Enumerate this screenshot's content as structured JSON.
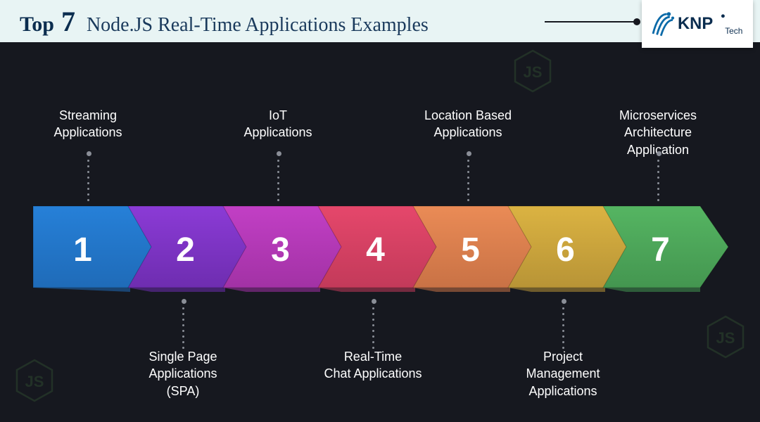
{
  "header": {
    "top_word": "Top",
    "number": "7",
    "subtitle": "Node.JS Real-Time Applications Examples"
  },
  "brand": {
    "name": "KNP Tech"
  },
  "items": [
    {
      "n": "1",
      "label_a": "Streaming",
      "label_b": "Applications",
      "label_c": "",
      "pos": "top",
      "color_a": "#2680d8",
      "color_b": "#1f6bb8"
    },
    {
      "n": "2",
      "label_a": "Single Page",
      "label_b": "Applications",
      "label_c": "(SPA)",
      "pos": "bottom",
      "color_a": "#8b3bd6",
      "color_b": "#6e2db0"
    },
    {
      "n": "3",
      "label_a": "IoT",
      "label_b": "Applications",
      "label_c": "",
      "pos": "top",
      "color_a": "#c23fc5",
      "color_b": "#a232a5"
    },
    {
      "n": "4",
      "label_a": "Real-Time",
      "label_b": "Chat Applications",
      "label_c": "",
      "pos": "bottom",
      "color_a": "#e5476b",
      "color_b": "#c33a5a"
    },
    {
      "n": "5",
      "label_a": "Location Based",
      "label_b": "Applications",
      "label_c": "",
      "pos": "top",
      "color_a": "#ea8b56",
      "color_b": "#c97245"
    },
    {
      "n": "6",
      "label_a": "Project",
      "label_b": "Management",
      "label_c": "Applications",
      "pos": "bottom",
      "color_a": "#dbb342",
      "color_b": "#b89436"
    },
    {
      "n": "7",
      "label_a": "Microservices",
      "label_b": "Architecture Application",
      "label_c": "",
      "pos": "top",
      "color_a": "#55b562",
      "color_b": "#449650"
    }
  ]
}
